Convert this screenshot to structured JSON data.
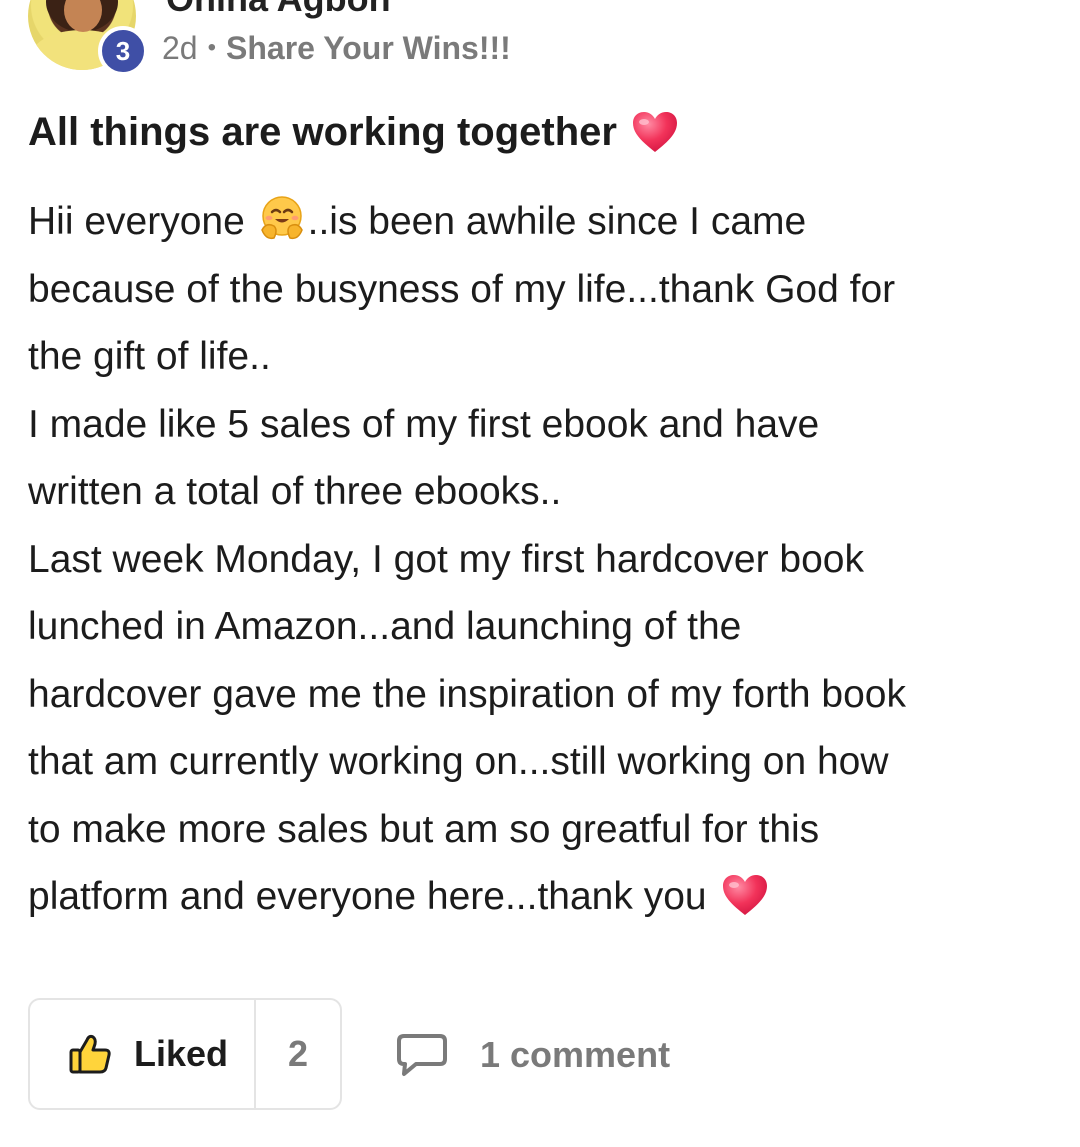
{
  "author": {
    "name": "Onina Agbon",
    "level": "3"
  },
  "meta": {
    "time": "2d",
    "separator": "•",
    "category": "Share Your Wins!!!"
  },
  "post": {
    "title": "All things are working together",
    "lines": [
      {
        "text": "Hii everyone ",
        "after": "..is been awhile since I came"
      },
      "because of the busyness of my life...thank God for",
      "the gift of life..",
      "I made like 5 sales of my first ebook and have",
      "written a total of three ebooks..",
      "Last week Monday, I got my first hardcover book",
      "lunched in Amazon...and launching of the",
      "hardcover gave me the inspiration of my forth book",
      "that am currently working on...still working on how",
      "to make more sales but am so greatful for this",
      "platform and everyone here...thank you"
    ]
  },
  "actions": {
    "like_label": "Liked",
    "like_count": "2",
    "comment_label": "1 comment"
  },
  "icons": {
    "heart": "red-heart-emoji",
    "hug": "hugging-face-emoji",
    "thumb": "thumbs-up-icon",
    "comment": "speech-bubble-icon"
  },
  "colors": {
    "badge": "#3f4fa6",
    "heart": "#e8234a",
    "muted_text": "#7a7a7a"
  }
}
